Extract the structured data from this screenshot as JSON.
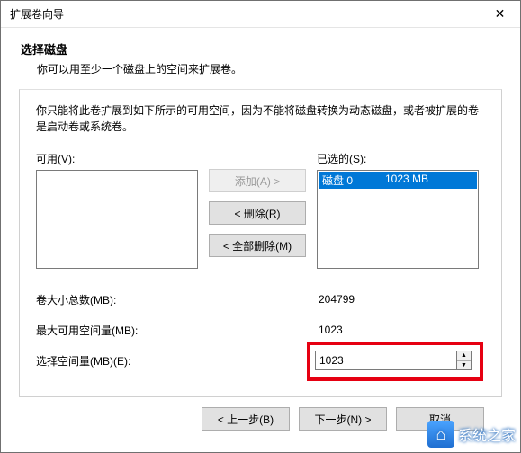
{
  "title": "扩展卷向导",
  "heading": "选择磁盘",
  "subheading": "你可以用至少一个磁盘上的空间来扩展卷。",
  "group_desc": "你只能将此卷扩展到如下所示的可用空间，因为不能将磁盘转换为动态磁盘，或者被扩展的卷是启动卷或系统卷。",
  "available": {
    "label": "可用(V):",
    "items": []
  },
  "selected": {
    "label": "已选的(S):",
    "items": [
      {
        "name": "磁盘 0",
        "size": "1023 MB",
        "selected": true
      }
    ]
  },
  "buttons": {
    "add": "添加(A) >",
    "remove": "< 删除(R)",
    "remove_all": "< 全部删除(M)",
    "back": "< 上一步(B)",
    "next": "下一步(N) >",
    "cancel": "取消"
  },
  "fields": {
    "total_label": "卷大小总数(MB):",
    "total_value": "204799",
    "max_label": "最大可用空间量(MB):",
    "max_value": "1023",
    "select_label": "选择空间量(MB)(E):",
    "select_value": "1023"
  },
  "watermark": "系统之家"
}
